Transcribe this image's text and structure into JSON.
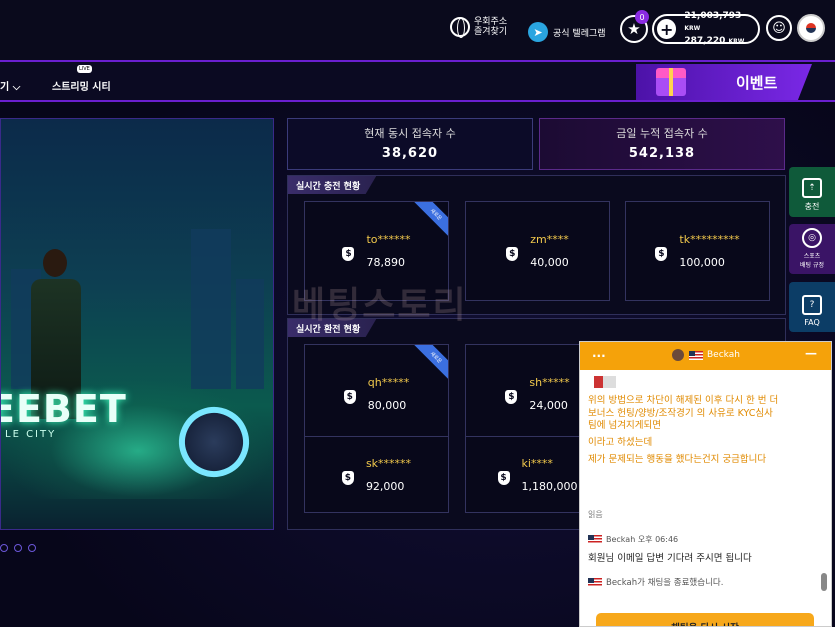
{
  "topbar": {
    "domain_bookmark_label": "우회주소\n즐겨찾기",
    "domain_line1": "우회주소",
    "domain_line2": "즐겨찾기",
    "telegram_label": "공식 텔레그램",
    "notification_count": "0",
    "balance_primary": "21,003,793",
    "balance_secondary": "287,220",
    "currency": "KRW"
  },
  "nav": {
    "partial_item": "기",
    "streaming_label": "스트리밍 시티",
    "live_tag": "LIVE",
    "event_label": "이벤트"
  },
  "banner": {
    "title": "EEBET",
    "subtitle": "LE CITY",
    "slide_count": 3
  },
  "stats": {
    "concurrent_label": "현재 동시 접속자 수",
    "concurrent_value": "38,620",
    "cumulative_label": "금일 누적 접속자 수",
    "cumulative_value": "542,138"
  },
  "deposits": {
    "title": "실시간 충전 현황",
    "items": [
      {
        "user": "to******",
        "amount": "78,890",
        "ribbon": "새로운"
      },
      {
        "user": "zm****",
        "amount": "40,000"
      },
      {
        "user": "tk*********",
        "amount": "100,000"
      }
    ]
  },
  "withdrawals": {
    "title": "실시간 환전 현황",
    "items": [
      {
        "user": "qh*****",
        "amount": "80,000",
        "ribbon": "새로운"
      },
      {
        "user": "sh*****",
        "amount": "24,000"
      },
      {
        "user": "sk******",
        "amount": "92,000"
      },
      {
        "user": "ki****",
        "amount": "1,180,000"
      }
    ]
  },
  "watermark": "베팅스토리",
  "side_nav": {
    "charge": "충전",
    "sports_line1": "스포츠",
    "sports_line2": "배팅 규정",
    "faq": "FAQ"
  },
  "chat": {
    "agent_name": "Beckah",
    "messages_orange": [
      "위의 방법으로 차단이 해제된 이후 다시 한 번 더 보너스 헌팅/양방/조작경기 의 사유로 KYC심사팀에 넘겨지게되면",
      "이라고 하셨는데",
      "제가 문제되는 행동을 했다는건지 궁금합니다"
    ],
    "read_label": "읽음",
    "agent_meta": "Beckah 오후 06:46",
    "agent_message": "회원님 이메일 답변 기다려 주시면 됩니다",
    "system_message": "Beckah가 채팅을 종료했습니다.",
    "restart_label": "채팅을 다시 시작"
  }
}
